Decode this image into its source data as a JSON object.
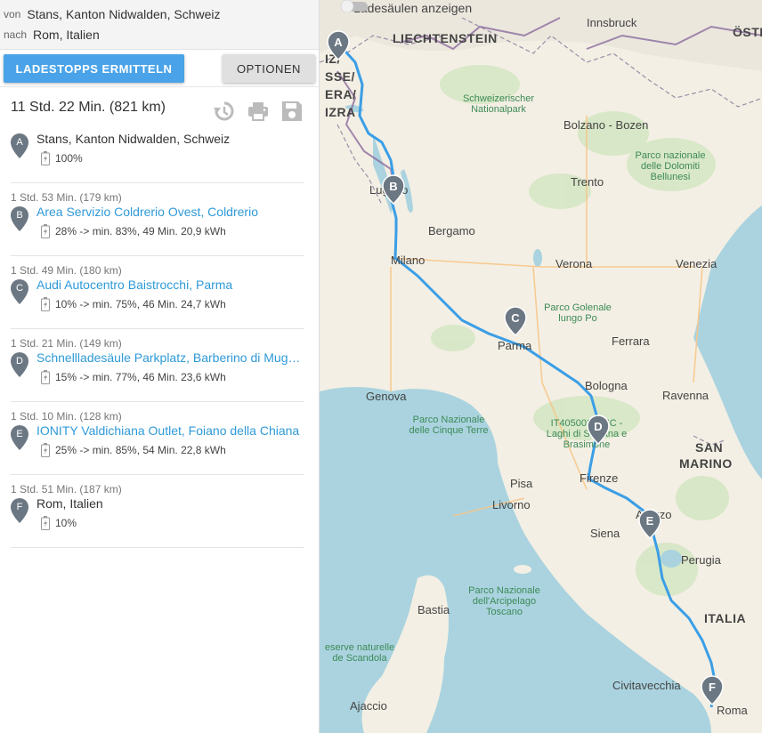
{
  "route": {
    "from_label": "von",
    "from_value": "Stans, Kanton Nidwalden, Schweiz",
    "to_label": "nach",
    "to_value": "Rom, Italien"
  },
  "actions": {
    "calc_button": "LADESTOPPS ERMITTELN",
    "options_button": "OPTIONEN"
  },
  "summary": {
    "total": "11 Std. 22 Min. (821 km)"
  },
  "icons": {
    "history": "history-icon",
    "print": "print-icon",
    "save": "save-icon",
    "pin": "map-pin-icon",
    "battery": "battery-icon"
  },
  "colors": {
    "accent": "#4aa3e8",
    "link": "#2f9ad8",
    "pin": "#6b7782",
    "route": "#3b9ee6",
    "water": "#aad3df"
  },
  "stops": [
    {
      "letter": "A",
      "leg": "",
      "name": "Stans, Kanton Nidwalden, Schweiz",
      "link": false,
      "charge": "100%"
    },
    {
      "letter": "B",
      "leg": "1 Std. 53 Min. (179 km)",
      "name": "Area Servizio Coldrerio Ovest, Coldrerio",
      "link": true,
      "charge": "28% -> min. 83%, 49 Min. 20,9 kWh"
    },
    {
      "letter": "C",
      "leg": "1 Std. 49 Min. (180 km)",
      "name": "Audi Autocentro Baistrocchi, Parma",
      "link": true,
      "charge": "10% -> min. 75%, 46 Min. 24,7 kWh"
    },
    {
      "letter": "D",
      "leg": "1 Std. 21 Min. (149 km)",
      "name": "Schnellladesäule Parkplatz, Barberino di Mug…",
      "link": true,
      "charge": "15% -> min. 77%, 46 Min. 23,6 kWh"
    },
    {
      "letter": "E",
      "leg": "1 Std. 10 Min. (128 km)",
      "name": "IONITY Valdichiana Outlet, Foiano della Chiana",
      "link": true,
      "charge": "25% -> min. 85%, 54 Min. 22,8 kWh"
    },
    {
      "letter": "F",
      "leg": "1 Std. 51 Min. (187 km)",
      "name": "Rom, Italien",
      "link": false,
      "charge": "10%"
    }
  ],
  "map": {
    "toggle_label": "Ladesäulen anzeigen",
    "toggle_on": false,
    "countries": [
      "LIECHTENSTEIN",
      "ÖSTE",
      "SAN",
      "MARINO",
      "ITALIA"
    ],
    "swiss_label": [
      "IZ/",
      "SSE/",
      "ERA/",
      "IZRA"
    ],
    "cities": [
      "Innsbruck",
      "Bolzano - Bozen",
      "Trento",
      "Lugano",
      "Bergamo",
      "Milano",
      "Verona",
      "Venezia",
      "Parma",
      "Ferrara",
      "Bologna",
      "Ravenna",
      "Genova",
      "Firenze",
      "Pisa",
      "Livorno",
      "Arezzo",
      "Siena",
      "Perugia",
      "Bastia",
      "Civitavecchia",
      "Roma",
      "Ajaccio"
    ],
    "parks": [
      "Schweizerischer Nationalpark",
      "Parco nazionale delle Dolomiti Bellunesi",
      "Parco Golenale lungo Po",
      "Parco Nazionale delle Cinque Terre",
      "IT4050027 SIC - Laghi di Suviana e Brasimone",
      "Parco Nazionale dell'Arcipelago Toscano",
      "eserve naturelle de Scandola"
    ]
  }
}
